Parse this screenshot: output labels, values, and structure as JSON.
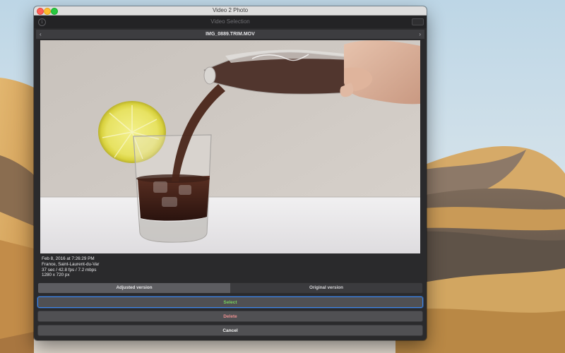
{
  "window": {
    "title": "Video 2 Photo"
  },
  "navbar": {
    "title": "Video Selection",
    "info_glyph": "i"
  },
  "file": {
    "name": "IMG_0889.TRIM.MOV",
    "prev_glyph": "‹",
    "next_glyph": "›"
  },
  "metadata": {
    "date": "Feb 8, 2016 at 7:26:29 PM",
    "location": "France, Saint-Laurent-du-Var",
    "stats": "37 sec / 42.8 fps / 7.2 mbps",
    "resolution": "1280 x 720 px"
  },
  "version_control": {
    "options": [
      "Adjusted version",
      "Original version"
    ],
    "selected": "Adjusted version"
  },
  "buttons": {
    "select": "Select",
    "delete": "Delete",
    "cancel": "Cancel"
  },
  "colors": {
    "select_text": "#78d05c",
    "delete_text": "#ea8f8f",
    "focus_ring": "#3f86e8"
  }
}
